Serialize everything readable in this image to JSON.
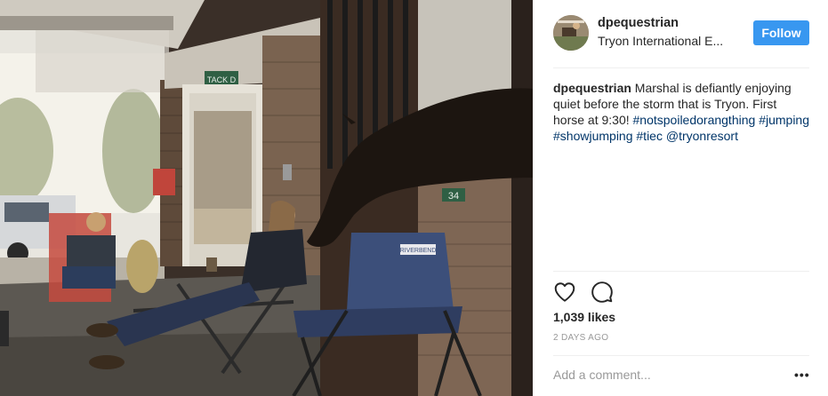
{
  "post": {
    "username": "dpequestrian",
    "location": "Tryon International E...",
    "follow_label": "Follow",
    "caption": {
      "user": "dpequestrian",
      "text": " Marshal is defiantly enjoying quiet before the storm that is Tryon. First horse at 9:30! ",
      "hashtags": [
        "#notspoiledorangthing",
        "#jumping",
        "#showjumping",
        "#tiec",
        "@tryonresort"
      ]
    },
    "likes_count": "1,039",
    "likes_label": " likes",
    "timestamp": "2 DAYS AGO",
    "comment_placeholder": "Add a comment...",
    "more_label": "•••"
  },
  "photo": {
    "sign_text": "TACK D",
    "stall_number": "34",
    "chair_brand": "RIVERBEND"
  },
  "icons": {
    "like": "heart-icon",
    "comment": "comment-bubble-icon",
    "more": "more-options-icon"
  },
  "colors": {
    "follow_button": "#3897f0",
    "hashtag": "#003569",
    "secondary_text": "#999999",
    "divider": "#efefef"
  }
}
